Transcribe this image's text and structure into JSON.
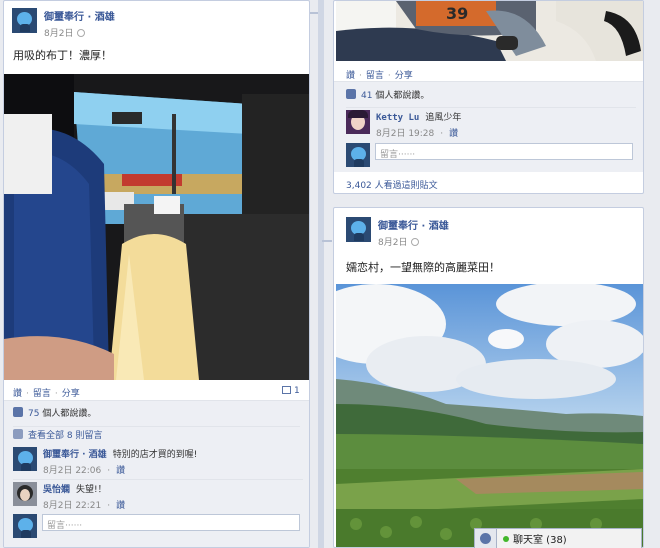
{
  "post1": {
    "author": "御璽奉行 · 酒雄",
    "date": "8月2日",
    "text": "用吸的布丁！濃厚！",
    "actions": {
      "like": "讚",
      "comment": "留言",
      "share": "分享"
    },
    "comment_count": "1",
    "likes_count": "75",
    "likes_suffix": "個人都說讚。",
    "view_all": "查看全部 8 則留言",
    "comments": [
      {
        "name": "御璽奉行 · 酒雄",
        "text": "特別的店才買的到喔!",
        "time": "8月2日 22:06",
        "like": "讚"
      },
      {
        "name": "吳怡嫻",
        "text": "失望!！",
        "time": "8月2日 22:21",
        "like": "讚"
      }
    ],
    "comment_placeholder": "留言‧‧‧‧‧‧"
  },
  "post2": {
    "actions": {
      "like": "讚",
      "comment": "留言",
      "share": "分享"
    },
    "likes_count": "41",
    "likes_suffix": "個人都說讚。",
    "comments": [
      {
        "name": "Ketty Lu",
        "text": "追風少年",
        "time": "8月2日 19:28",
        "like": "讚"
      }
    ],
    "comment_placeholder": "留言‧‧‧‧‧‧",
    "views": "3,402 人看過這則貼文"
  },
  "post3": {
    "author": "御璽奉行 · 酒雄",
    "date": "8月2日",
    "text": "嬬恋村，一望無際的高麗菜田！"
  },
  "chat": {
    "label": "聊天室 (38)"
  },
  "colors": {
    "link": "#3b5998",
    "background": "#e9ebf0",
    "card_border": "#c4cde0"
  }
}
